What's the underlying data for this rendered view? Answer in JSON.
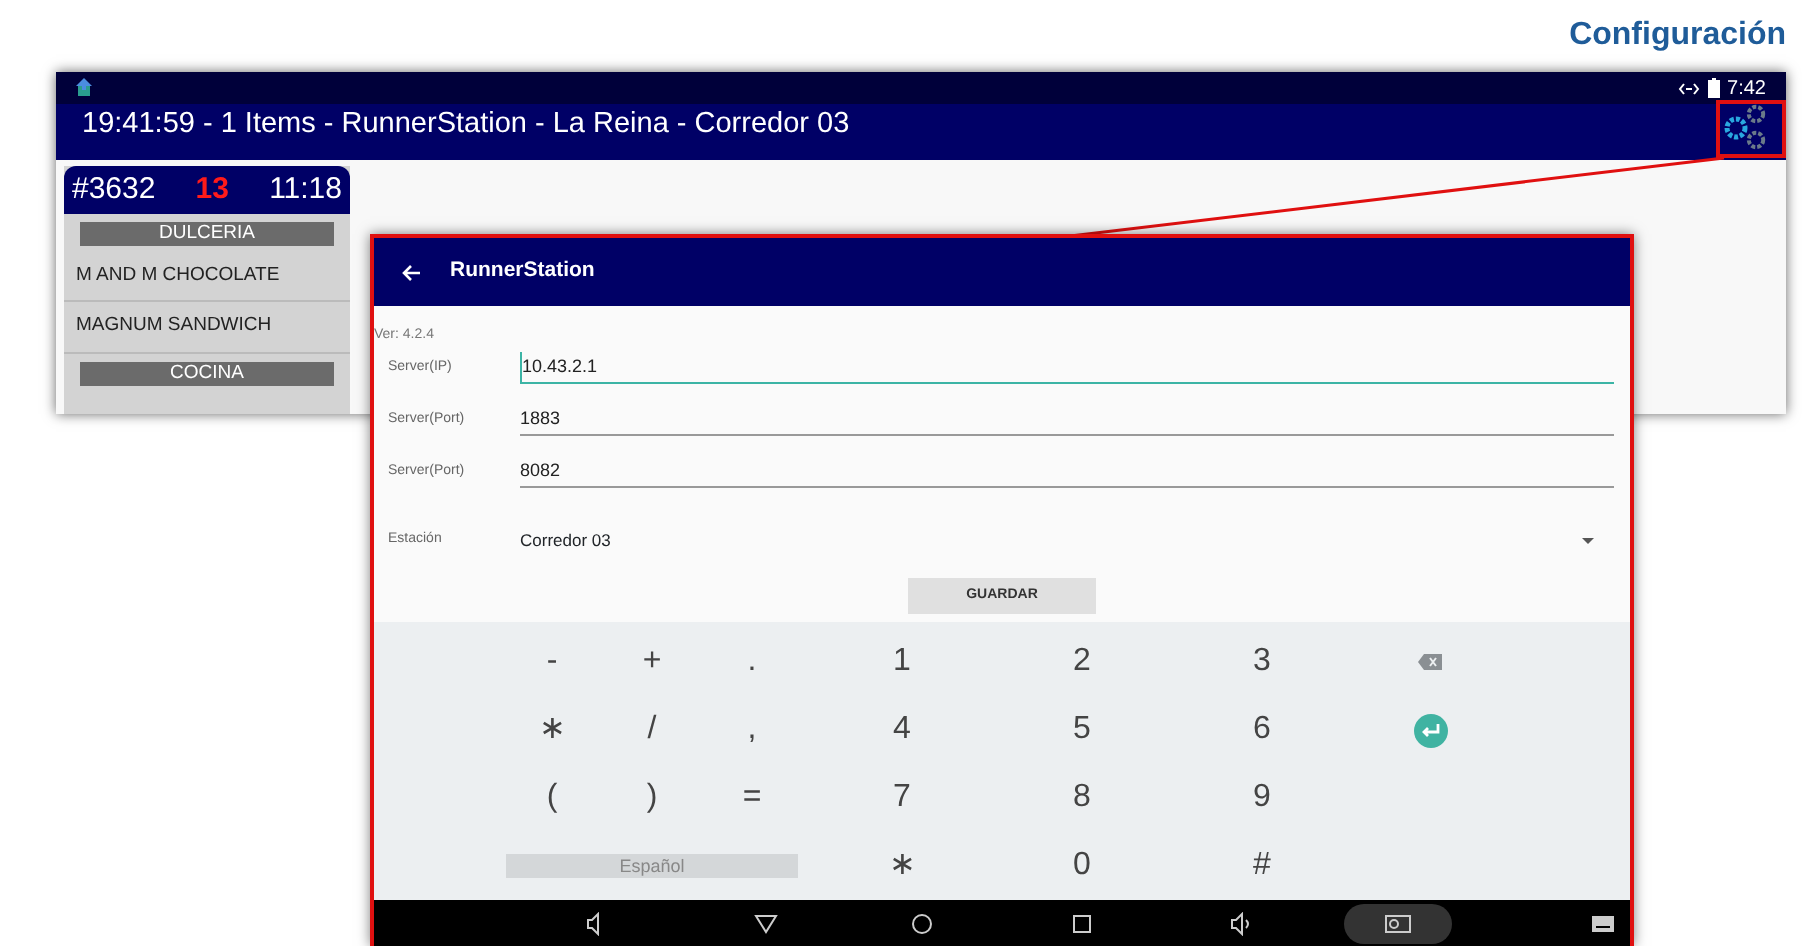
{
  "page_title": "Configuración",
  "main_window": {
    "status_time": "7:42",
    "title": "19:41:59 - 1 Items - RunnerStation - La Reina - Corredor 03",
    "order": {
      "number": "#3632",
      "count": "13",
      "time": "11:18",
      "sections": [
        {
          "name": "DULCERIA",
          "items": [
            "M AND M CHOCOLATE",
            "MAGNUM SANDWICH"
          ]
        },
        {
          "name": "COCINA"
        }
      ]
    }
  },
  "dialog": {
    "title": "RunnerStation",
    "version": "Ver: 4.2.4",
    "fields": [
      {
        "label": "Server(IP)",
        "value": "10.43.2.1",
        "focused": true
      },
      {
        "label": "Server(Port)",
        "value": "1883",
        "focused": false
      },
      {
        "label": "Server(Port)",
        "value": "8082",
        "focused": false
      }
    ],
    "station": {
      "label": "Estación",
      "value": "Corredor 03"
    },
    "save_button": "GUARDAR",
    "keyboard": [
      [
        {
          "kind": "key",
          "label": "-"
        },
        {
          "kind": "key",
          "label": "+"
        },
        {
          "kind": "key",
          "label": "."
        },
        {
          "kind": "key",
          "label": "1"
        },
        {
          "kind": "key",
          "label": "2"
        },
        {
          "kind": "key",
          "label": "3"
        },
        {
          "kind": "backspace"
        }
      ],
      [
        {
          "kind": "key",
          "label": "∗"
        },
        {
          "kind": "key",
          "label": "/"
        },
        {
          "kind": "key",
          "label": ","
        },
        {
          "kind": "key",
          "label": "4"
        },
        {
          "kind": "key",
          "label": "5"
        },
        {
          "kind": "key",
          "label": "6"
        },
        {
          "kind": "enter"
        }
      ],
      [
        {
          "kind": "key",
          "label": "("
        },
        {
          "kind": "key",
          "label": ")"
        },
        {
          "kind": "key",
          "label": "="
        },
        {
          "kind": "key",
          "label": "7"
        },
        {
          "kind": "key",
          "label": "8"
        },
        {
          "kind": "key",
          "label": "9"
        }
      ],
      [
        {
          "kind": "language",
          "label": "Español"
        },
        {
          "kind": "key",
          "label": "∗"
        },
        {
          "kind": "key",
          "label": "0"
        },
        {
          "kind": "key",
          "label": "#"
        }
      ]
    ]
  }
}
